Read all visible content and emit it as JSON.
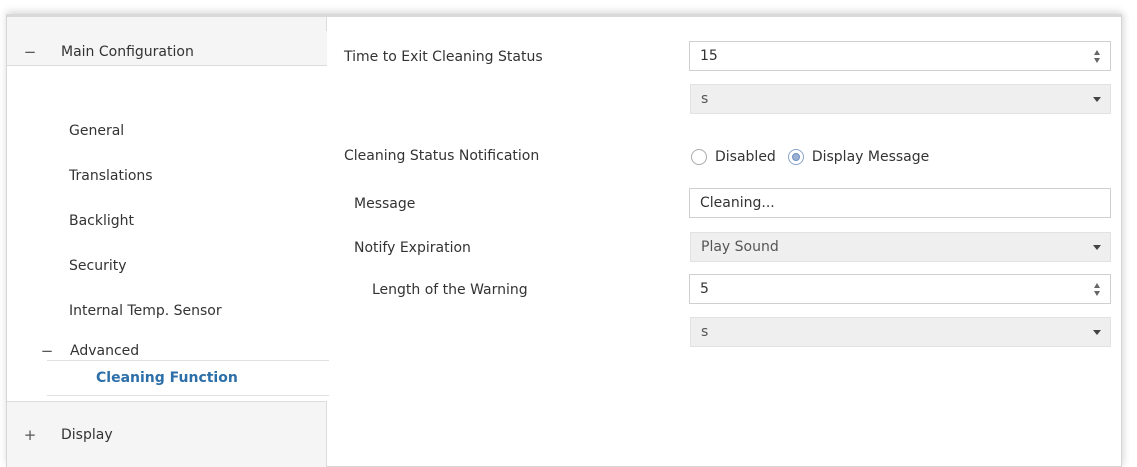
{
  "sidebar": {
    "main_group": {
      "sign": "−",
      "label": "Main Configuration"
    },
    "items": [
      "General",
      "Translations",
      "Backlight",
      "Security",
      "Internal Temp. Sensor"
    ],
    "advanced": {
      "sign": "−",
      "label": "Advanced"
    },
    "active_item": "Cleaning Function",
    "display_group": {
      "sign": "+",
      "label": "Display"
    }
  },
  "form": {
    "exit_time": {
      "label": "Time to Exit Cleaning Status",
      "value": "15",
      "unit": "s"
    },
    "notification": {
      "label": "Cleaning Status Notification",
      "options": [
        "Disabled",
        "Display Message"
      ],
      "selected": "Display Message"
    },
    "message": {
      "label": "Message",
      "value": "Cleaning..."
    },
    "notify_expiration": {
      "label": "Notify Expiration",
      "value": "Play Sound"
    },
    "warning_length": {
      "label": "Length of the Warning",
      "value": "5",
      "unit": "s"
    }
  },
  "colors": {
    "active_item": "#2d6fa8",
    "radio_selected": "#9ab1d3"
  }
}
